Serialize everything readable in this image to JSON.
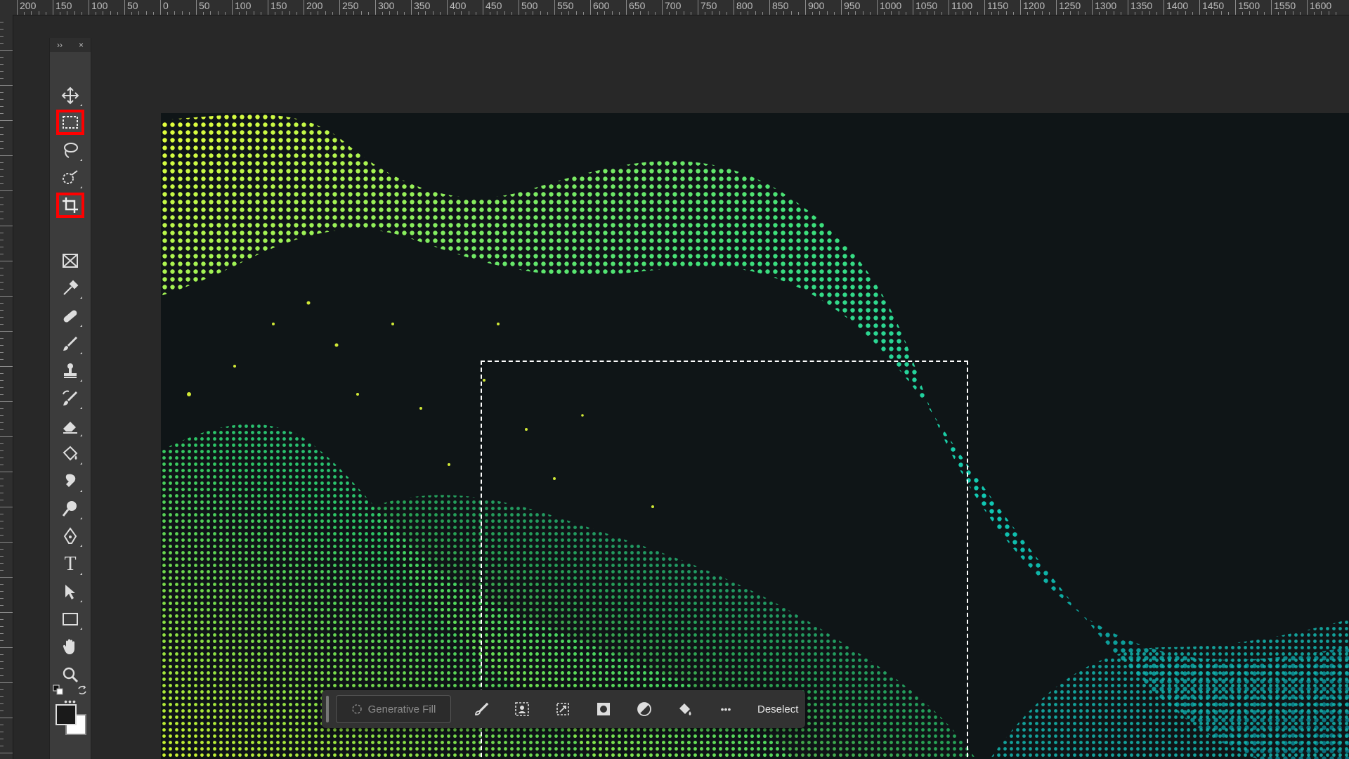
{
  "ruler": {
    "top_labels": [
      "200",
      "150",
      "100",
      "50",
      "0",
      "50",
      "100",
      "150",
      "200",
      "250",
      "300",
      "350",
      "400",
      "450",
      "500",
      "550",
      "600",
      "650",
      "700",
      "750",
      "800",
      "850",
      "900",
      "950",
      "1000",
      "1050",
      "1100",
      "1150",
      "1200",
      "1250",
      "1300",
      "1350",
      "1400",
      "1450",
      "1500",
      "1550",
      "1600"
    ]
  },
  "toolbar": {
    "expand_label": "››",
    "close_label": "×",
    "tools": [
      {
        "name": "move-tool",
        "icon": "move-icon",
        "highlighted": false
      },
      {
        "name": "rectangular-marquee-tool",
        "icon": "marquee-icon",
        "highlighted": true
      },
      {
        "name": "lasso-tool",
        "icon": "lasso-icon",
        "highlighted": false
      },
      {
        "name": "quick-selection-tool",
        "icon": "quick-selection-icon",
        "highlighted": false
      },
      {
        "name": "crop-tool",
        "icon": "crop-icon",
        "highlighted": true
      },
      {
        "name": "frame-tool",
        "icon": "frame-icon",
        "highlighted": false
      },
      {
        "name": "eyedropper-tool",
        "icon": "eyedropper-icon",
        "highlighted": false
      },
      {
        "name": "healing-brush-tool",
        "icon": "bandage-icon",
        "highlighted": false
      },
      {
        "name": "brush-tool",
        "icon": "brush-icon",
        "highlighted": false
      },
      {
        "name": "clone-stamp-tool",
        "icon": "stamp-icon",
        "highlighted": false
      },
      {
        "name": "history-brush-tool",
        "icon": "history-brush-icon",
        "highlighted": false
      },
      {
        "name": "eraser-tool",
        "icon": "eraser-icon",
        "highlighted": false
      },
      {
        "name": "paint-bucket-tool",
        "icon": "paint-bucket-icon",
        "highlighted": false
      },
      {
        "name": "smudge-tool",
        "icon": "smudge-icon",
        "highlighted": false
      },
      {
        "name": "dodge-tool",
        "icon": "dodge-icon",
        "highlighted": false
      },
      {
        "name": "pen-tool",
        "icon": "pen-icon",
        "highlighted": false
      },
      {
        "name": "type-tool",
        "icon": "type-icon",
        "highlighted": false
      },
      {
        "name": "path-selection-tool",
        "icon": "arrow-icon",
        "highlighted": false
      },
      {
        "name": "rectangle-tool",
        "icon": "rectangle-icon",
        "highlighted": false
      },
      {
        "name": "hand-tool",
        "icon": "hand-icon",
        "highlighted": false
      },
      {
        "name": "zoom-tool",
        "icon": "zoom-icon",
        "highlighted": false
      },
      {
        "name": "edit-toolbar",
        "icon": "more-icon",
        "highlighted": false
      }
    ],
    "type_glyph": "T",
    "more_glyph": "•••",
    "highlight_color": "#ff0000"
  },
  "colors": {
    "foreground": "#1a1a1a",
    "background": "#ffffff"
  },
  "taskbar": {
    "generative_fill_label": "Generative Fill",
    "more_label": "•••",
    "deselect_label": "Deselect",
    "icons": [
      "brush-select-icon",
      "select-subject-icon",
      "transform-selection-icon",
      "mask-icon",
      "invert-icon",
      "fill-icon"
    ]
  }
}
